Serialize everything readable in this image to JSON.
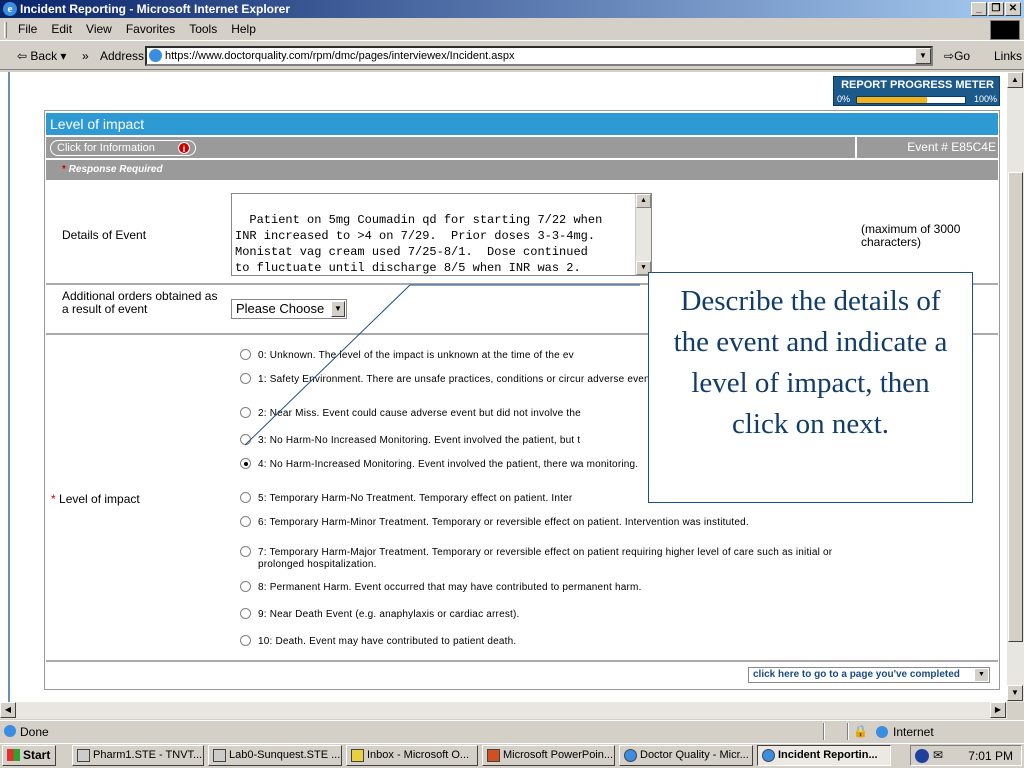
{
  "window": {
    "title": "Incident Reporting - Microsoft Internet Explorer"
  },
  "menu": [
    "File",
    "Edit",
    "View",
    "Favorites",
    "Tools",
    "Help"
  ],
  "toolbar": {
    "back": "Back",
    "address_label": "Address",
    "url": "https://www.doctorquality.com/rpm/dmc/pages/interviewex/Incident.aspx",
    "go": "Go",
    "links": "Links"
  },
  "meter": {
    "title": "REPORT PROGRESS METER",
    "min": "0%",
    "max": "100%",
    "progress": 0.65
  },
  "form": {
    "section_title": "Level of impact",
    "info_button": "Click for Information",
    "event_number": "Event # E85C4E",
    "required_note": "Response Required",
    "details_label": "Details of Event",
    "details_text": "Patient on 5mg Coumadin qd for starting 7/22 when\nINR increased to >4 on 7/29.  Prior doses 3-3-4mg.\nMonistat vag cream used 7/25-8/1.  Dose continued\nto fluctuate until discharge 8/5 when INR was 2.",
    "max_note": "(maximum of 3000 characters)",
    "orders_label": "Additional orders obtained as a result of event",
    "orders_value": "Please Choose",
    "impact_label": "Level of impact",
    "options": [
      "0: Unknown. The level of the impact is unknown at the time of the ev",
      "1: Safety Environment. There are unsafe practices, conditions or circur adverse event.",
      "2: Near Miss. Event could cause adverse event but did not involve the",
      "3: No Harm-No Increased Monitoring. Event involved the patient, but t",
      "4: No Harm-Increased Monitoring. Event involved the patient, there wa monitoring.",
      "5: Temporary Harm-No Treatment. Temporary effect on patient. Inter",
      "6: Temporary Harm-Minor Treatment. Temporary or reversible effect on patient. Intervention was instituted.",
      "7: Temporary Harm-Major Treatment. Temporary or reversible effect on patient requiring higher level of care such as initial or prolonged hospitalization.",
      "8: Permanent Harm. Event occurred that may have contributed to permanent harm.",
      "9: Near Death Event (e.g. anaphylaxis or cardiac arrest).",
      "10: Death. Event may have contributed to patient death."
    ],
    "selected_option": 4,
    "jump_select": "click here to go to a page you've completed"
  },
  "callout": {
    "text": "Describe the details of the event and indicate a level of impact, then click on next."
  },
  "status": {
    "text": "Done",
    "zone": "Internet"
  },
  "taskbar": {
    "start": "Start",
    "tasks": [
      "Pharm1.STE - TNVT...",
      "Lab0-Sunquest.STE ...",
      "Inbox - Microsoft O...",
      "Microsoft PowerPoin...",
      "Doctor Quality - Micr...",
      "Incident Reportin..."
    ],
    "clock": "7:01 PM"
  }
}
